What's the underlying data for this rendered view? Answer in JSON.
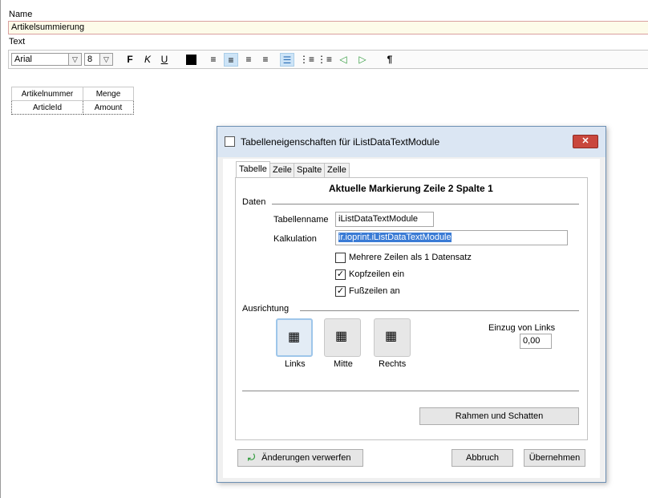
{
  "form": {
    "name_label": "Name",
    "name_value": "Artikelsummierung",
    "text_label": "Text"
  },
  "toolbar": {
    "font_name": "Arial",
    "font_size": "8",
    "bold": "F",
    "italic": "K",
    "underline": "U",
    "paragraph": "¶"
  },
  "preview_table": {
    "headers": [
      "Artikelnummer",
      "Menge"
    ],
    "row": [
      "ArticleId",
      "Amount"
    ]
  },
  "dialog": {
    "title": "Tabelleneigenschaften für iListDataTextModule",
    "close": "✕",
    "tabs": [
      "Tabelle",
      "Zeile",
      "Spalte",
      "Zelle"
    ],
    "marking": "Aktuelle Markierung Zeile 2 Spalte 1",
    "section_data": "Daten",
    "table_name_label": "Tabellenname",
    "table_name_value": "iListDataTextModule",
    "calc_label": "Kalkulation",
    "calc_value": "ir.ioprint.iListDataTextModule",
    "check_multi": "Mehrere Zeilen als 1 Datensatz",
    "check_header": "Kopfzeilen ein",
    "check_footer": "Fußzeilen an",
    "section_align": "Ausrichtung",
    "align_left": "Links",
    "align_center": "Mitte",
    "align_right": "Rechts",
    "indent_label": "Einzug von Links",
    "indent_value": "0,00",
    "border_button": "Rahmen und Schatten",
    "discard_button": "Änderungen verwerfen",
    "cancel_button": "Abbruch",
    "apply_button": "Übernehmen"
  }
}
